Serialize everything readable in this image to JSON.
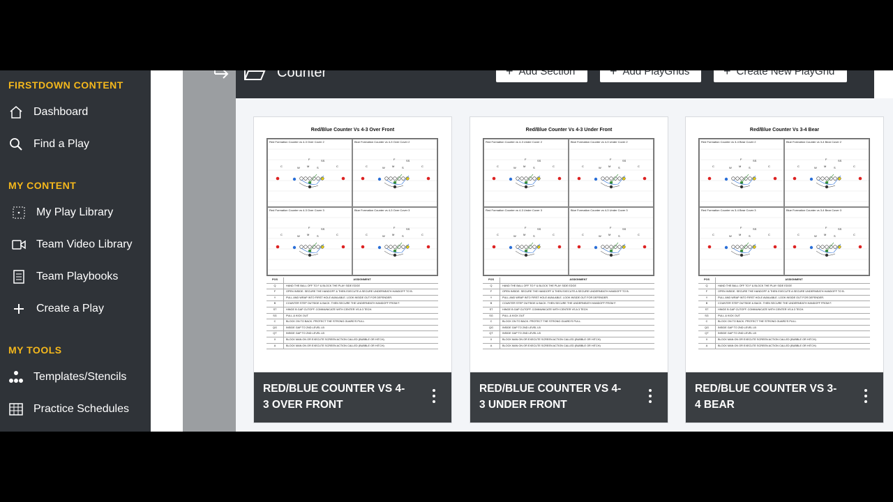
{
  "sidebar": {
    "sections": [
      {
        "label": "FIRSTDOWN CONTENT"
      },
      {
        "label": "MY CONTENT"
      },
      {
        "label": "MY TOOLS"
      }
    ],
    "items": [
      {
        "label": "Dashboard",
        "icon": "home-icon"
      },
      {
        "label": "Find a Play",
        "icon": "search-icon"
      },
      {
        "label": "My Play Library",
        "icon": "dotted-grid-icon"
      },
      {
        "label": "Team Video Library",
        "icon": "video-icon"
      },
      {
        "label": "Team Playbooks",
        "icon": "book-icon"
      },
      {
        "label": "Create a Play",
        "icon": "plus-icon"
      },
      {
        "label": "Templates/Stencils",
        "icon": "nodes-icon"
      },
      {
        "label": "Practice Schedules",
        "icon": "table-icon"
      }
    ],
    "accent_color": "#f5b81c"
  },
  "header": {
    "title": "Counter",
    "buttons": {
      "add_section": "Add Section",
      "add_playgrids": "Add PlayGrids",
      "create_new_playgrid": "Create New PlayGrid"
    }
  },
  "cards": [
    {
      "title": "Red/Blue Counter Vs 4-3 Over Front",
      "sheet_title": "Red/Blue Counter Vs 4-3 Over Front",
      "diagrams": [
        "Red Formation Counter vs 4-3 Over Cover 2",
        "Blue Formation Counter vs 4-3 Over Cover 2",
        "Red Formation Counter vs 4-3 Over Cover 3",
        "Blue Formation Counter vs 4-3 Over Cover 3"
      ]
    },
    {
      "title": "Red/Blue Counter Vs 4-3 Under Front",
      "sheet_title": "Red/Blue Counter Vs 4-3 Under Front",
      "diagrams": [
        "Red Formation Counter vs 4-3 Under Cover 2",
        "Blue Formation Counter vs 4-3 Under Cover 2",
        "Red Formation Counter vs 4-3 Under Cover 3",
        "Blue Formation Counter vs 4-3 Under Cover 3"
      ]
    },
    {
      "title": "Red/Blue Counter Vs 3-4 Bear",
      "sheet_title": "Red/Blue Counter Vs 3-4 Bear",
      "diagrams": [
        "Red Formation Counter vs 3-4 Bear Cover 2",
        "Blue Formation Counter vs 3-4 Bear Cover 2",
        "Red Formation Counter vs 3-4 Bear Cover 3",
        "Blue Formation Counter vs 3-4 Bear Cover 3"
      ]
    }
  ],
  "assignment_table": {
    "headers": [
      "POS",
      "ASSIGNMENT"
    ],
    "rows": [
      [
        "Q",
        "HAND THE BALL OFF TO F & BLOCK THE PLAY SIDE EDGE"
      ],
      [
        "F",
        "OPEN INSIDE. SECURE THE HANDOFF & THEN EXECUTE A SECURE UNDERNEATH HANDOFF TO B."
      ],
      [
        "Y",
        "PULL AND WRAP INTO FIRST HOLE AVAILABLE. LOOK INSIDE OUT FOR DEFENDER."
      ],
      [
        "B",
        "COUNTER STEP OUTSIDE & BACK. THEN SECURE THE UNDERNEATH HANDOFF FROM F."
      ],
      [
        "ST",
        "HINGE B GAP CUTOFF. COMMUNICATE WITH CENTER VS A 3 TECH."
      ],
      [
        "SG",
        "PULL & KICK OUT"
      ],
      [
        "C",
        "BLOCK ON TO BACK. PROTECT THE STRONG GUARD'S PULL."
      ],
      [
        "QG",
        "INSIDE GAP TO 2ND LEVEL LB"
      ],
      [
        "QT",
        "INSIDE GAP TO 2ND LEVEL LB"
      ],
      [
        "X",
        "BLOCK MAN ON OR EXECUTE SCREEN ACTION CALLED (BUBBLE OR HITCH)"
      ],
      [
        "A",
        "BLOCK MAN ON OR EXECUTE SCREEN ACTION CALLED (BUBBLE OR HITCH)"
      ]
    ]
  }
}
